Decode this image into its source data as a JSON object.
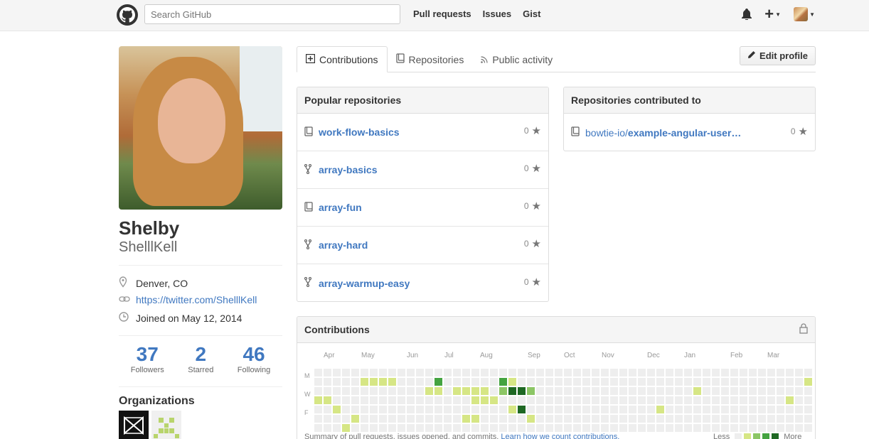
{
  "header": {
    "search_placeholder": "Search GitHub",
    "nav": [
      "Pull requests",
      "Issues",
      "Gist"
    ],
    "plus_label": "+"
  },
  "profile": {
    "fullname": "Shelby",
    "username": "ShelllKell",
    "location": "Denver, CO",
    "url": "https://twitter.com/ShelllKell",
    "joined": "Joined on May 12, 2014",
    "stats": [
      {
        "num": "37",
        "label": "Followers"
      },
      {
        "num": "2",
        "label": "Starred"
      },
      {
        "num": "46",
        "label": "Following"
      }
    ],
    "organizations_title": "Organizations"
  },
  "tabs": [
    "Contributions",
    "Repositories",
    "Public activity"
  ],
  "edit_profile": "Edit profile",
  "popular": {
    "title": "Popular repositories",
    "repos": [
      {
        "name": "work-flow-basics",
        "type": "repo",
        "stars": "0"
      },
      {
        "name": "array-basics",
        "type": "fork",
        "stars": "0"
      },
      {
        "name": "array-fun",
        "type": "repo",
        "stars": "0"
      },
      {
        "name": "array-hard",
        "type": "fork",
        "stars": "0"
      },
      {
        "name": "array-warmup-easy",
        "type": "fork",
        "stars": "0"
      }
    ]
  },
  "contributed": {
    "title": "Repositories contributed to",
    "repos": [
      {
        "owner": "bowtie-io/",
        "name": "example-angular-user…",
        "stars": "0"
      }
    ]
  },
  "contributions": {
    "title": "Contributions",
    "months": [
      "Apr",
      "May",
      "Jun",
      "Jul",
      "Aug",
      "Sep",
      "Oct",
      "Nov",
      "Dec",
      "Jan",
      "Feb",
      "Mar"
    ],
    "days": [
      "M",
      "W",
      "F"
    ],
    "summary": "Summary of pull requests, issues opened, and commits.",
    "learn_link": "Learn how we count contributions.",
    "legend_less": "Less",
    "legend_more": "More",
    "colors": [
      "#eeeeee",
      "#d6e685",
      "#8cc665",
      "#44a340",
      "#1e6823"
    ]
  }
}
